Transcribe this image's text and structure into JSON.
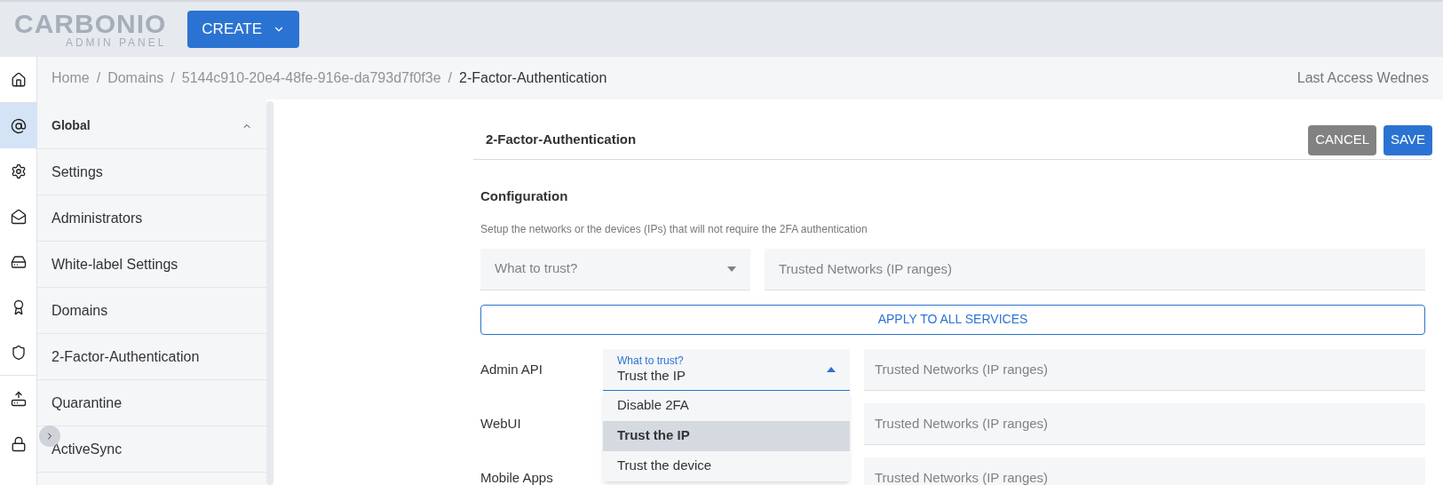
{
  "header": {
    "logo": "CARBONIO",
    "logo_sub": "ADMIN PANEL",
    "create_button": "CREATE"
  },
  "rail": [
    {
      "kind": "home",
      "selected": false
    },
    {
      "kind": "at",
      "selected": true
    },
    {
      "kind": "gear",
      "selected": false
    },
    {
      "kind": "mail",
      "selected": false
    },
    {
      "kind": "drive",
      "selected": false
    },
    {
      "kind": "award",
      "selected": false
    },
    {
      "kind": "shield",
      "selected": false
    },
    {
      "kind": "backup",
      "selected": false
    },
    {
      "kind": "lock",
      "selected": false
    }
  ],
  "breadcrumb_separator": "/",
  "breadcrumb": [
    "Home",
    "Domains",
    "5144c910-20e4-48fe-916e-da793d7f0f3e",
    "2-Factor-Authentication"
  ],
  "last_access": "Last Access Wednes",
  "sidebar": {
    "section": "Global",
    "expanded": true,
    "items": [
      {
        "label": "Settings",
        "selected": false
      },
      {
        "label": "Administrators",
        "selected": false
      },
      {
        "label": "White-label Settings",
        "selected": false
      },
      {
        "label": "Domains",
        "selected": false
      },
      {
        "label": "2-Factor-Authentication",
        "selected": false
      },
      {
        "label": "Quarantine",
        "selected": false
      },
      {
        "label": "ActiveSync",
        "selected": false
      }
    ]
  },
  "panel": {
    "title": "2-Factor-Authentication",
    "buttons": [
      {
        "label": "CANCEL",
        "kind": "secondary"
      },
      {
        "label": "SAVE",
        "kind": "primary"
      }
    ],
    "section": "Configuration",
    "description": "Setup the networks or the devices (IPs) that will not require the 2FA authentication",
    "global_select": {
      "placeholder": "What to trust?"
    },
    "global_field": {
      "placeholder": "Trusted Networks (IP ranges)"
    },
    "apply_button": "APPLY TO ALL SERVICES",
    "services": [
      {
        "label": "Admin API",
        "select": {
          "label": "What to trust?",
          "value": "Trust the IP",
          "expanded": true,
          "options": [
            {
              "label": "Disable 2FA",
              "selected": false
            },
            {
              "label": "Trust the IP",
              "selected": true
            },
            {
              "label": "Trust the device",
              "selected": false
            }
          ]
        },
        "field": {
          "placeholder": "Trusted Networks (IP ranges)"
        }
      },
      {
        "label": "WebUI",
        "field": {
          "placeholder": "Trusted Networks (IP ranges)"
        }
      },
      {
        "label": "Mobile Apps",
        "field": {
          "placeholder": "Trusted Networks (IP ranges)"
        }
      }
    ]
  }
}
